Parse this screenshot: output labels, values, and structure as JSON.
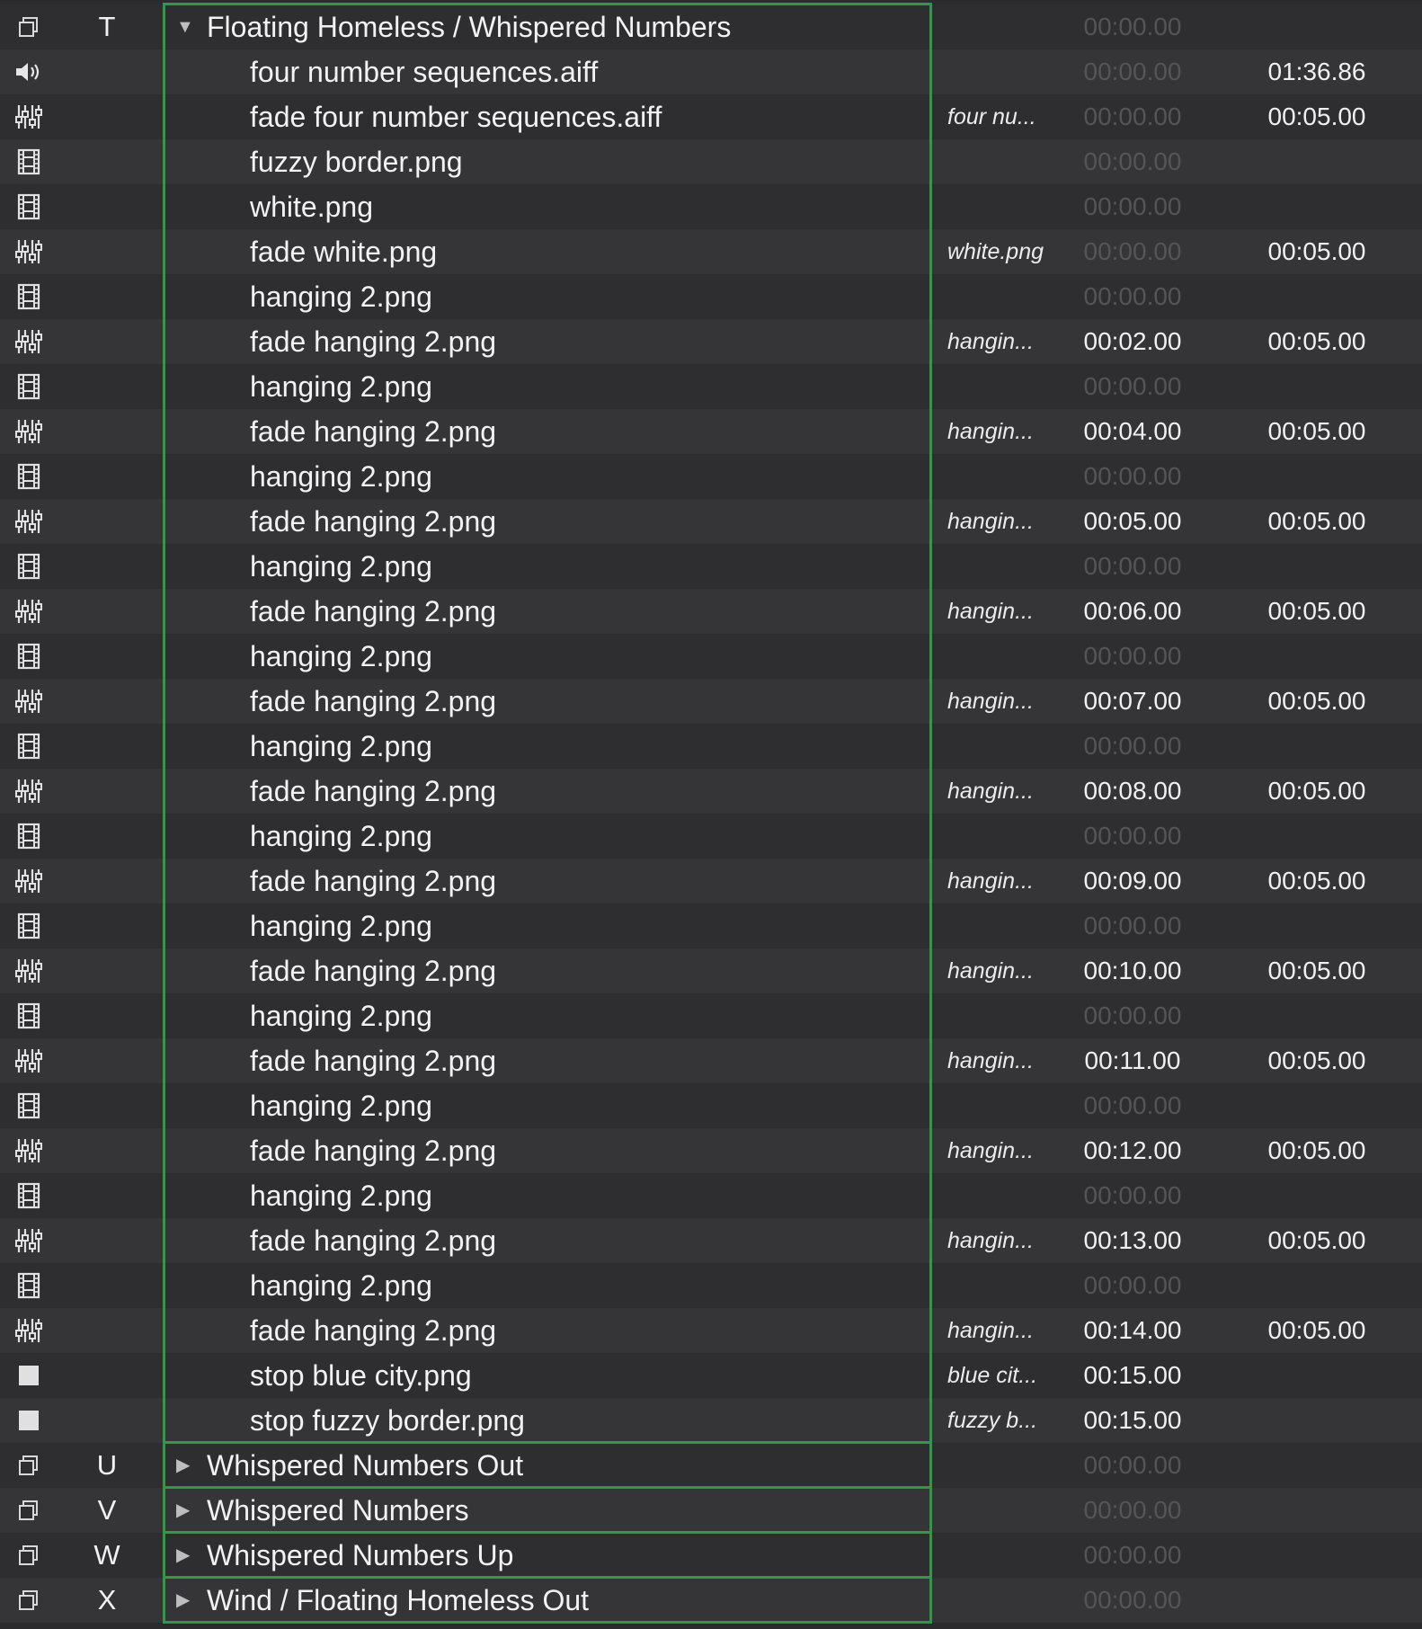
{
  "colors": {
    "group_border": "#2f9a44",
    "row_odd": "#2e2e30",
    "row_even": "#353537",
    "dim_time": "#555558"
  },
  "cues": [
    {
      "type": "group-icon",
      "number": "T",
      "name": "Floating Homeless / Whispered Numbers",
      "target": "",
      "prewait": "00:00.00",
      "prewait_dim": true,
      "duration": "",
      "level": 0,
      "expanded": true
    },
    {
      "type": "speaker-icon",
      "number": "",
      "name": "four number sequences.aiff",
      "target": "",
      "prewait": "00:00.00",
      "prewait_dim": true,
      "duration": "01:36.86",
      "level": 1
    },
    {
      "type": "fade-icon",
      "number": "",
      "name": "fade four number sequences.aiff",
      "target": "four nu...",
      "prewait": "00:00.00",
      "prewait_dim": true,
      "duration": "00:05.00",
      "level": 1
    },
    {
      "type": "film-icon",
      "number": "",
      "name": "fuzzy border.png",
      "target": "",
      "prewait": "00:00.00",
      "prewait_dim": true,
      "duration": "",
      "level": 1
    },
    {
      "type": "film-icon",
      "number": "",
      "name": "white.png",
      "target": "",
      "prewait": "00:00.00",
      "prewait_dim": true,
      "duration": "",
      "level": 1
    },
    {
      "type": "fade-icon",
      "number": "",
      "name": "fade white.png",
      "target": "white.png",
      "prewait": "00:00.00",
      "prewait_dim": true,
      "duration": "00:05.00",
      "level": 1
    },
    {
      "type": "film-icon",
      "number": "",
      "name": "hanging 2.png",
      "target": "",
      "prewait": "00:00.00",
      "prewait_dim": true,
      "duration": "",
      "level": 1
    },
    {
      "type": "fade-icon",
      "number": "",
      "name": "fade hanging 2.png",
      "target": "hangin...",
      "prewait": "00:02.00",
      "prewait_dim": false,
      "duration": "00:05.00",
      "level": 1
    },
    {
      "type": "film-icon",
      "number": "",
      "name": "hanging 2.png",
      "target": "",
      "prewait": "00:00.00",
      "prewait_dim": true,
      "duration": "",
      "level": 1
    },
    {
      "type": "fade-icon",
      "number": "",
      "name": "fade hanging 2.png",
      "target": "hangin...",
      "prewait": "00:04.00",
      "prewait_dim": false,
      "duration": "00:05.00",
      "level": 1
    },
    {
      "type": "film-icon",
      "number": "",
      "name": "hanging 2.png",
      "target": "",
      "prewait": "00:00.00",
      "prewait_dim": true,
      "duration": "",
      "level": 1
    },
    {
      "type": "fade-icon",
      "number": "",
      "name": "fade hanging 2.png",
      "target": "hangin...",
      "prewait": "00:05.00",
      "prewait_dim": false,
      "duration": "00:05.00",
      "level": 1
    },
    {
      "type": "film-icon",
      "number": "",
      "name": "hanging 2.png",
      "target": "",
      "prewait": "00:00.00",
      "prewait_dim": true,
      "duration": "",
      "level": 1
    },
    {
      "type": "fade-icon",
      "number": "",
      "name": "fade hanging 2.png",
      "target": "hangin...",
      "prewait": "00:06.00",
      "prewait_dim": false,
      "duration": "00:05.00",
      "level": 1
    },
    {
      "type": "film-icon",
      "number": "",
      "name": "hanging 2.png",
      "target": "",
      "prewait": "00:00.00",
      "prewait_dim": true,
      "duration": "",
      "level": 1
    },
    {
      "type": "fade-icon",
      "number": "",
      "name": "fade hanging 2.png",
      "target": "hangin...",
      "prewait": "00:07.00",
      "prewait_dim": false,
      "duration": "00:05.00",
      "level": 1
    },
    {
      "type": "film-icon",
      "number": "",
      "name": "hanging 2.png",
      "target": "",
      "prewait": "00:00.00",
      "prewait_dim": true,
      "duration": "",
      "level": 1
    },
    {
      "type": "fade-icon",
      "number": "",
      "name": "fade hanging 2.png",
      "target": "hangin...",
      "prewait": "00:08.00",
      "prewait_dim": false,
      "duration": "00:05.00",
      "level": 1
    },
    {
      "type": "film-icon",
      "number": "",
      "name": "hanging 2.png",
      "target": "",
      "prewait": "00:00.00",
      "prewait_dim": true,
      "duration": "",
      "level": 1
    },
    {
      "type": "fade-icon",
      "number": "",
      "name": "fade hanging 2.png",
      "target": "hangin...",
      "prewait": "00:09.00",
      "prewait_dim": false,
      "duration": "00:05.00",
      "level": 1
    },
    {
      "type": "film-icon",
      "number": "",
      "name": "hanging 2.png",
      "target": "",
      "prewait": "00:00.00",
      "prewait_dim": true,
      "duration": "",
      "level": 1
    },
    {
      "type": "fade-icon",
      "number": "",
      "name": "fade hanging 2.png",
      "target": "hangin...",
      "prewait": "00:10.00",
      "prewait_dim": false,
      "duration": "00:05.00",
      "level": 1
    },
    {
      "type": "film-icon",
      "number": "",
      "name": "hanging 2.png",
      "target": "",
      "prewait": "00:00.00",
      "prewait_dim": true,
      "duration": "",
      "level": 1
    },
    {
      "type": "fade-icon",
      "number": "",
      "name": "fade hanging 2.png",
      "target": "hangin...",
      "prewait": "00:11.00",
      "prewait_dim": false,
      "duration": "00:05.00",
      "level": 1
    },
    {
      "type": "film-icon",
      "number": "",
      "name": "hanging 2.png",
      "target": "",
      "prewait": "00:00.00",
      "prewait_dim": true,
      "duration": "",
      "level": 1
    },
    {
      "type": "fade-icon",
      "number": "",
      "name": "fade hanging 2.png",
      "target": "hangin...",
      "prewait": "00:12.00",
      "prewait_dim": false,
      "duration": "00:05.00",
      "level": 1
    },
    {
      "type": "film-icon",
      "number": "",
      "name": "hanging 2.png",
      "target": "",
      "prewait": "00:00.00",
      "prewait_dim": true,
      "duration": "",
      "level": 1
    },
    {
      "type": "fade-icon",
      "number": "",
      "name": "fade hanging 2.png",
      "target": "hangin...",
      "prewait": "00:13.00",
      "prewait_dim": false,
      "duration": "00:05.00",
      "level": 1
    },
    {
      "type": "film-icon",
      "number": "",
      "name": "hanging 2.png",
      "target": "",
      "prewait": "00:00.00",
      "prewait_dim": true,
      "duration": "",
      "level": 1
    },
    {
      "type": "fade-icon",
      "number": "",
      "name": "fade hanging 2.png",
      "target": "hangin...",
      "prewait": "00:14.00",
      "prewait_dim": false,
      "duration": "00:05.00",
      "level": 1
    },
    {
      "type": "stop-icon",
      "number": "",
      "name": "stop blue city.png",
      "target": "blue cit...",
      "prewait": "00:15.00",
      "prewait_dim": false,
      "duration": "",
      "level": 1
    },
    {
      "type": "stop-icon",
      "number": "",
      "name": "stop fuzzy border.png",
      "target": "fuzzy b...",
      "prewait": "00:15.00",
      "prewait_dim": false,
      "duration": "",
      "level": 1
    },
    {
      "type": "group-icon",
      "number": "U",
      "name": "Whispered Numbers Out",
      "target": "",
      "prewait": "00:00.00",
      "prewait_dim": true,
      "duration": "",
      "level": 0,
      "expanded": false
    },
    {
      "type": "group-icon",
      "number": "V",
      "name": "Whispered Numbers",
      "target": "",
      "prewait": "00:00.00",
      "prewait_dim": true,
      "duration": "",
      "level": 0,
      "expanded": false
    },
    {
      "type": "group-icon",
      "number": "W",
      "name": "Whispered Numbers Up",
      "target": "",
      "prewait": "00:00.00",
      "prewait_dim": true,
      "duration": "",
      "level": 0,
      "expanded": false
    },
    {
      "type": "group-icon",
      "number": "X",
      "name": "Wind / Floating Homeless Out",
      "target": "",
      "prewait": "00:00.00",
      "prewait_dim": true,
      "duration": "",
      "level": 0,
      "expanded": false
    }
  ]
}
